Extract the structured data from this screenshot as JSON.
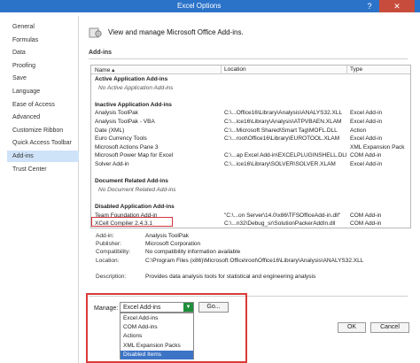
{
  "window": {
    "title": "Excel Options",
    "help_icon": "question-mark-icon",
    "close_icon": "close-icon"
  },
  "sidebar": {
    "items": [
      {
        "label": "General"
      },
      {
        "label": "Formulas"
      },
      {
        "label": "Data"
      },
      {
        "label": "Proofing"
      },
      {
        "label": "Save"
      },
      {
        "label": "Language"
      },
      {
        "label": "Ease of Access"
      },
      {
        "label": "Advanced"
      },
      {
        "label": "Customize Ribbon"
      },
      {
        "label": "Quick Access Toolbar"
      },
      {
        "label": "Add-ins"
      },
      {
        "label": "Trust Center"
      }
    ],
    "active_index": 10
  },
  "header": {
    "text": "View and manage Microsoft Office Add-ins.",
    "icon": "add-ins-icon"
  },
  "section": {
    "title": "Add-ins"
  },
  "grid": {
    "columns": [
      "Name ▴",
      "Location",
      "Type"
    ],
    "rows": [
      {
        "kind": "group",
        "name": "Active Application Add-ins",
        "location": "",
        "type": ""
      },
      {
        "kind": "empty",
        "name": "No Active Application Add-ins",
        "location": "",
        "type": ""
      },
      {
        "kind": "gap",
        "name": "",
        "location": "",
        "type": ""
      },
      {
        "kind": "group",
        "name": "Inactive Application Add-ins",
        "location": "",
        "type": ""
      },
      {
        "kind": "item",
        "name": "Analysis ToolPak",
        "location": "C:\\...Office16\\Library\\Analysis\\ANALYS32.XLL",
        "type": "Excel Add-in"
      },
      {
        "kind": "item",
        "name": "Analysis ToolPak - VBA",
        "location": "C:\\...ice16\\Library\\Analysis\\ATPVBAEN.XLAM",
        "type": "Excel Add-in"
      },
      {
        "kind": "item",
        "name": "Date (XML)",
        "location": "C:\\...Microsoft Shared\\Smart Tag\\MOFL.DLL",
        "type": "Action"
      },
      {
        "kind": "item",
        "name": "Euro Currency Tools",
        "location": "C:\\...root\\Office16\\Library\\EUROTOOL.XLAM",
        "type": "Excel Add-in"
      },
      {
        "kind": "item",
        "name": "Microsoft Actions Pane 3",
        "location": "",
        "type": "XML Expansion Pack"
      },
      {
        "kind": "item",
        "name": "Microsoft Power Map for Excel",
        "location": "C:\\...ap Excel Add-in\\EXCELPLUGINSHELL.DLL",
        "type": "COM Add-in"
      },
      {
        "kind": "item",
        "name": "Solver Add-in",
        "location": "C:\\...ice16\\Library\\SOLVER\\SOLVER.XLAM",
        "type": "Excel Add-in"
      },
      {
        "kind": "gap",
        "name": "",
        "location": "",
        "type": ""
      },
      {
        "kind": "group",
        "name": "Document Related Add-ins",
        "location": "",
        "type": ""
      },
      {
        "kind": "empty",
        "name": "No Document Related Add-ins",
        "location": "",
        "type": ""
      },
      {
        "kind": "gap",
        "name": "",
        "location": "",
        "type": ""
      },
      {
        "kind": "group",
        "name": "Disabled Application Add-ins",
        "location": "",
        "type": ""
      },
      {
        "kind": "item",
        "name": "Team Foundation Add-in",
        "location": "\"C:\\...on Server\\14.0\\x86\\TFSOfficeAdd-in.dll\"",
        "type": "COM Add-in"
      },
      {
        "kind": "item",
        "name": "XCell Compiler 2.4.3.1",
        "location": "C:\\...n32\\Debug_sr\\SolutionPackerAddIn.dll",
        "type": "COM Add-in"
      }
    ]
  },
  "details": [
    {
      "label": "Add-in:",
      "value": "Analysis ToolPak"
    },
    {
      "label": "Publisher:",
      "value": "Microsoft Corporation"
    },
    {
      "label": "Compatibility:",
      "value": "No compatibility information available"
    },
    {
      "label": "Location:",
      "value": "C:\\Program Files (x86)\\Microsoft Office\\root\\Office16\\Library\\Analysis\\ANALYS32.XLL"
    },
    {
      "label": "",
      "value": ""
    },
    {
      "label": "Description:",
      "value": "Provides data analysis tools for statistical and engineering analysis"
    }
  ],
  "manage": {
    "label": "Manage:",
    "selected": "Excel Add-ins",
    "go_label": "Go...",
    "options": [
      "Excel Add-ins",
      "COM Add-ins",
      "Actions",
      "XML Expansion Packs",
      "Disabled Items"
    ],
    "highlighted_index": 4
  },
  "buttons": {
    "ok": "OK",
    "cancel": "Cancel"
  }
}
